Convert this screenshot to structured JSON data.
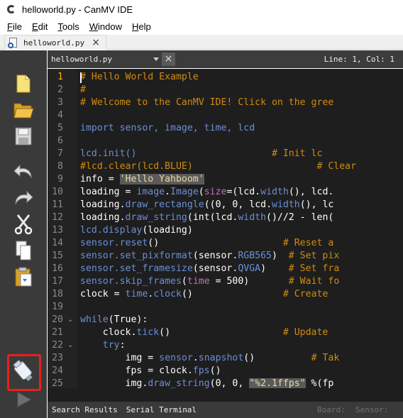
{
  "window": {
    "title": "helloworld.py - CanMV IDE"
  },
  "menu": [
    {
      "key": "F",
      "rest": "ile"
    },
    {
      "key": "E",
      "rest": "dit"
    },
    {
      "key": "T",
      "rest": "ools"
    },
    {
      "key": "W",
      "rest": "indow"
    },
    {
      "key": "H",
      "rest": "elp"
    }
  ],
  "file_tab": {
    "label": "helloworld.py",
    "close": "×"
  },
  "editor_header": {
    "document": "helloworld.py",
    "close": "×",
    "position": "Line: 1, Col: 1"
  },
  "toolbar": {
    "tools": [
      "new-file-icon",
      "open-folder-icon",
      "save-icon",
      "undo-icon",
      "redo-icon",
      "cut-icon",
      "copy-icon",
      "paste-icon",
      "connect-icon",
      "run-icon"
    ],
    "highlight_color": "#e8201f"
  },
  "editor": {
    "current_line": 1,
    "lines": [
      [
        {
          "t": "# Hello World Example",
          "c": "com"
        }
      ],
      [
        {
          "t": "#",
          "c": "com"
        }
      ],
      [
        {
          "t": "# Welcome to the CanMV IDE! Click on the gree",
          "c": "com"
        }
      ],
      [],
      [
        {
          "t": "import",
          "c": "kw"
        },
        {
          "t": " sensor, image, time, lcd",
          "c": "kw"
        }
      ],
      [],
      [
        {
          "t": "lcd.init",
          "c": "fn"
        },
        {
          "t": "()",
          "c": "fn"
        },
        {
          "t": "                        ",
          "c": "plain"
        },
        {
          "t": "# Init lc",
          "c": "com"
        }
      ],
      [
        {
          "t": "#lcd.clear(lcd.BLUE)",
          "c": "com"
        },
        {
          "t": "                      ",
          "c": "plain"
        },
        {
          "t": "# Clear",
          "c": "com"
        }
      ],
      [
        {
          "t": "info = ",
          "c": "plain"
        },
        {
          "t": "'Hello Yahboom'",
          "c": "str"
        }
      ],
      [
        {
          "t": "loading = ",
          "c": "plain"
        },
        {
          "t": "image",
          "c": "fn"
        },
        {
          "t": ".",
          "c": "plain"
        },
        {
          "t": "Image",
          "c": "fn"
        },
        {
          "t": "(",
          "c": "plain"
        },
        {
          "t": "size",
          "c": "num"
        },
        {
          "t": "=(lcd.",
          "c": "plain"
        },
        {
          "t": "width",
          "c": "fn"
        },
        {
          "t": "(), lcd.",
          "c": "plain"
        }
      ],
      [
        {
          "t": "loading.",
          "c": "plain"
        },
        {
          "t": "draw_rectangle",
          "c": "fn"
        },
        {
          "t": "((",
          "c": "plain"
        },
        {
          "t": "0",
          "c": "plain"
        },
        {
          "t": ", ",
          "c": "plain"
        },
        {
          "t": "0",
          "c": "plain"
        },
        {
          "t": ", lcd.",
          "c": "plain"
        },
        {
          "t": "width",
          "c": "fn"
        },
        {
          "t": "(), lc",
          "c": "plain"
        }
      ],
      [
        {
          "t": "loading.",
          "c": "plain"
        },
        {
          "t": "draw_string",
          "c": "fn"
        },
        {
          "t": "(int(lcd.",
          "c": "plain"
        },
        {
          "t": "width",
          "c": "fn"
        },
        {
          "t": "()//2 - len(",
          "c": "plain"
        }
      ],
      [
        {
          "t": "lcd.",
          "c": "fn"
        },
        {
          "t": "display",
          "c": "fn"
        },
        {
          "t": "(loading)",
          "c": "plain"
        }
      ],
      [
        {
          "t": "sensor.",
          "c": "fn"
        },
        {
          "t": "reset",
          "c": "fn"
        },
        {
          "t": "()",
          "c": "plain"
        },
        {
          "t": "                      ",
          "c": "plain"
        },
        {
          "t": "# Reset a",
          "c": "com"
        }
      ],
      [
        {
          "t": "sensor.",
          "c": "fn"
        },
        {
          "t": "set_pixformat",
          "c": "fn"
        },
        {
          "t": "(sensor.",
          "c": "plain"
        },
        {
          "t": "RGB565",
          "c": "fn"
        },
        {
          "t": ")  ",
          "c": "plain"
        },
        {
          "t": "# Set pix",
          "c": "com"
        }
      ],
      [
        {
          "t": "sensor.",
          "c": "fn"
        },
        {
          "t": "set_framesize",
          "c": "fn"
        },
        {
          "t": "(sensor.",
          "c": "plain"
        },
        {
          "t": "QVGA",
          "c": "fn"
        },
        {
          "t": ")    ",
          "c": "plain"
        },
        {
          "t": "# Set fra",
          "c": "com"
        }
      ],
      [
        {
          "t": "sensor.",
          "c": "fn"
        },
        {
          "t": "skip_frames",
          "c": "fn"
        },
        {
          "t": "(",
          "c": "plain"
        },
        {
          "t": "time",
          "c": "num"
        },
        {
          "t": " = 500)       ",
          "c": "plain"
        },
        {
          "t": "# Wait fo",
          "c": "com"
        }
      ],
      [
        {
          "t": "clock = ",
          "c": "plain"
        },
        {
          "t": "time",
          "c": "fn"
        },
        {
          "t": ".",
          "c": "plain"
        },
        {
          "t": "clock",
          "c": "fn"
        },
        {
          "t": "()                ",
          "c": "plain"
        },
        {
          "t": "# Create",
          "c": "com"
        }
      ],
      [],
      [
        {
          "t": "while",
          "c": "kw"
        },
        {
          "t": "(True):",
          "c": "plain"
        }
      ],
      [
        {
          "t": "    clock.",
          "c": "plain"
        },
        {
          "t": "tick",
          "c": "fn"
        },
        {
          "t": "()                    ",
          "c": "plain"
        },
        {
          "t": "# Update",
          "c": "com"
        }
      ],
      [
        {
          "t": "    ",
          "c": "plain"
        },
        {
          "t": "try",
          "c": "kw"
        },
        {
          "t": ":",
          "c": "plain"
        }
      ],
      [
        {
          "t": "        img = ",
          "c": "plain"
        },
        {
          "t": "sensor",
          "c": "fn"
        },
        {
          "t": ".",
          "c": "plain"
        },
        {
          "t": "snapshot",
          "c": "fn"
        },
        {
          "t": "()          ",
          "c": "plain"
        },
        {
          "t": "# Tak",
          "c": "com"
        }
      ],
      [
        {
          "t": "        fps = clock.",
          "c": "plain"
        },
        {
          "t": "fps",
          "c": "fn"
        },
        {
          "t": "()",
          "c": "plain"
        }
      ],
      [
        {
          "t": "        img.",
          "c": "plain"
        },
        {
          "t": "draw_string",
          "c": "fn"
        },
        {
          "t": "(0, 0, ",
          "c": "plain"
        },
        {
          "t": "\"%2.1ffps\"",
          "c": "str"
        },
        {
          "t": " %(fp",
          "c": "plain"
        }
      ]
    ]
  },
  "bottom": {
    "tabs": [
      "Search Results",
      "Serial Terminal"
    ],
    "board_label": "Board:",
    "sensor_label": "Sensor:"
  }
}
